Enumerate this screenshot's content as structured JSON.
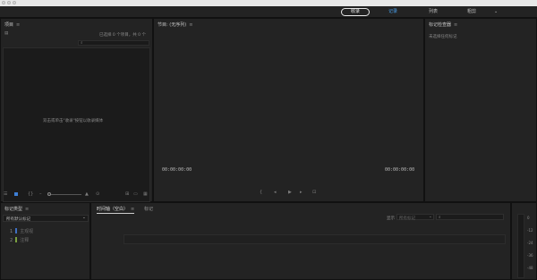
{
  "workspace": {
    "button": "收录",
    "tabs": [
      "记录",
      "列表",
      "粗剪"
    ],
    "menu_icon": "chevron-down-icon"
  },
  "project": {
    "title": "项目",
    "menu": "≡",
    "item_count": "已选择 0 个项目，共 0 个",
    "empty_message": "双击或单击\"收录\"按钮以收录媒体",
    "search_placeholder": ""
  },
  "sequence": {
    "title": "节目: (无序列)",
    "menu": "≡",
    "timecode_left": "00:00:00:00",
    "timecode_right": "00:00:00:00"
  },
  "markers_inspector": {
    "title": "标记检查器",
    "menu": "≡",
    "message": "未选择任何标记"
  },
  "marker_types": {
    "title": "标记类型",
    "menu": "≡",
    "dropdown": "所有默认标记",
    "items": [
      {
        "num": "1",
        "label": "主观视",
        "color": "#3f6fc2"
      },
      {
        "num": "2",
        "label": "注释",
        "color": "#7aa040"
      }
    ]
  },
  "timeline": {
    "tabs": [
      "时间轴（空白）",
      "标记"
    ],
    "tab_menu": "≡",
    "filter_label": "显示",
    "filter_dropdown": "所有标记",
    "search_placeholder": ""
  },
  "meter": {
    "ticks": [
      "0",
      "-12",
      "-24",
      "-36",
      "-48"
    ]
  }
}
